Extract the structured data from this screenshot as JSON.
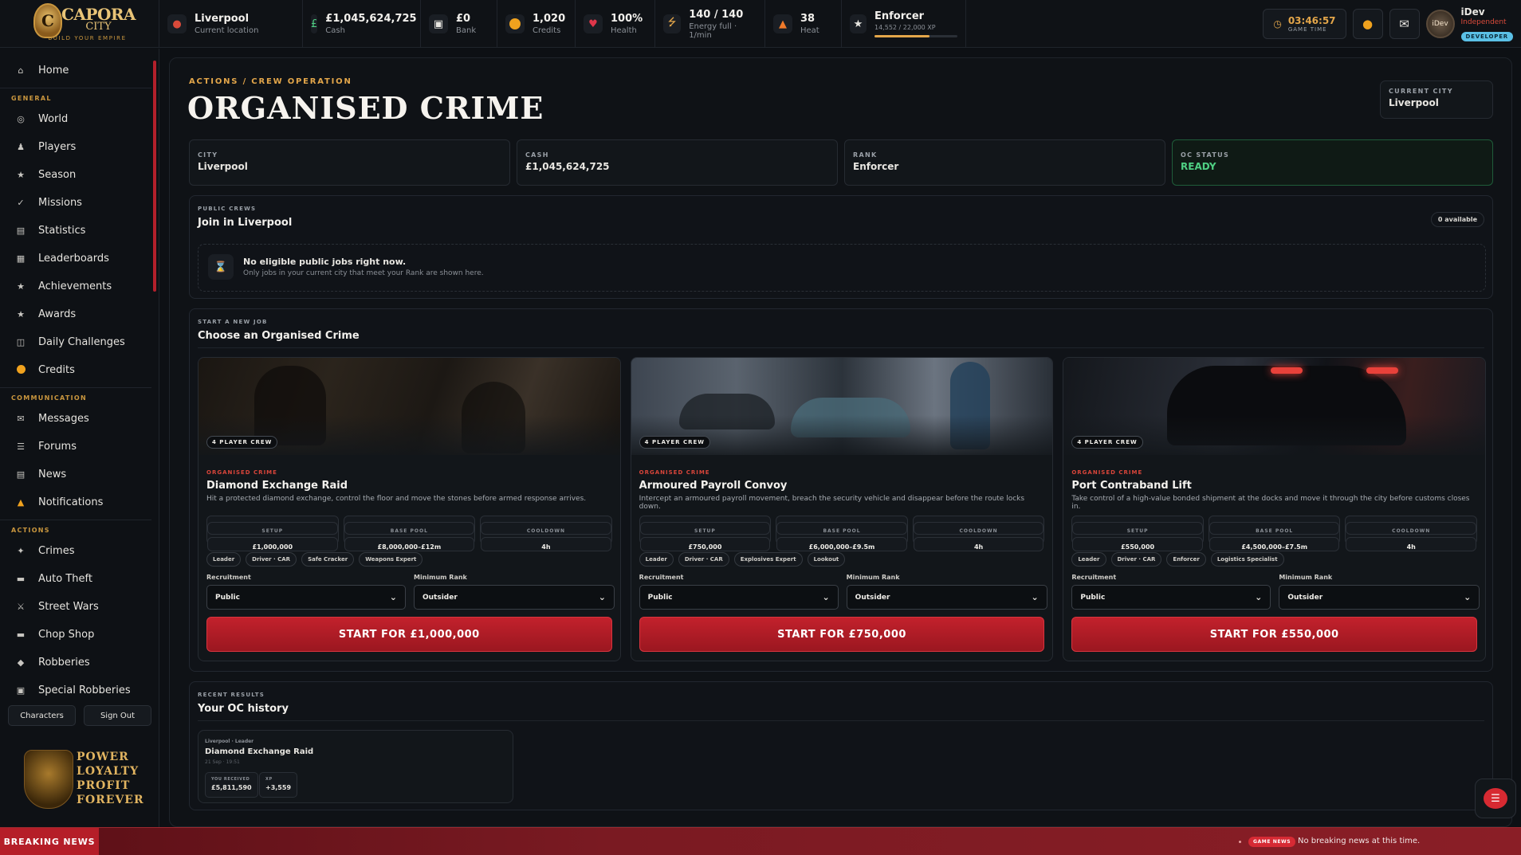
{
  "brand": {
    "name_line1": "CAPORA",
    "name_line2": "CITY",
    "tagline": "BUILD YOUR EMPIRE",
    "crest_letter": "C"
  },
  "topbar": {
    "location": {
      "value": "Liverpool",
      "label": "Current location",
      "icon": "location-pin-icon"
    },
    "cash": {
      "value": "£1,045,624,725",
      "label": "Cash",
      "icon": "pound-icon"
    },
    "bank": {
      "value": "£0",
      "label": "Bank",
      "icon": "bank-icon"
    },
    "credits": {
      "value": "1,020",
      "label": "Credits",
      "icon": "coin-icon"
    },
    "health": {
      "value": "100%",
      "label": "Health",
      "icon": "heart-icon"
    },
    "energy": {
      "value": "140 / 140",
      "label": "Energy full · 1/min",
      "icon": "bolt-icon"
    },
    "heat": {
      "value": "38",
      "label": "Heat",
      "icon": "flame-icon"
    },
    "rank": {
      "value": "Enforcer",
      "xp": "14,552 / 22,000 XP",
      "xp_fraction": 0.66,
      "icon": "rank-icon"
    },
    "game_time": {
      "value": "03:46:57",
      "label": "GAME TIME"
    },
    "user": {
      "name": "iDev",
      "faction": "Independent",
      "badge": "DEVELOPER",
      "avatar_text": "iDev"
    }
  },
  "sidebar": {
    "home": "Home",
    "sections": [
      {
        "title": "GENERAL",
        "items": [
          "World",
          "Players",
          "Season",
          "Missions",
          "Statistics",
          "Leaderboards",
          "Achievements",
          "Awards",
          "Daily Challenges",
          "Credits"
        ]
      },
      {
        "title": "COMMUNICATION",
        "items": [
          "Messages",
          "Forums",
          "News",
          "Notifications"
        ]
      },
      {
        "title": "ACTIONS",
        "items": [
          "Crimes",
          "Auto Theft",
          "Street Wars",
          "Chop Shop",
          "Robberies",
          "Special Robberies"
        ]
      }
    ],
    "characters_btn": "Characters",
    "signout_btn": "Sign Out",
    "motto": [
      "POWER",
      "LOYALTY",
      "PROFIT",
      "FOREVER"
    ]
  },
  "page": {
    "breadcrumb": "ACTIONS / CREW OPERATION",
    "title": "ORGANISED CRIME",
    "current_city_label": "CURRENT CITY",
    "current_city": "Liverpool",
    "stats": [
      {
        "label": "CITY",
        "value": "Liverpool"
      },
      {
        "label": "CASH",
        "value": "£1,045,624,725"
      },
      {
        "label": "RANK",
        "value": "Enforcer"
      },
      {
        "label": "OC STATUS",
        "value": "READY"
      }
    ],
    "public_crews": {
      "label": "PUBLIC CREWS",
      "title": "Join in Liverpool",
      "available": "0 available",
      "empty_title": "No eligible public jobs right now.",
      "empty_sub": "Only jobs in your current city that meet your Rank are shown here."
    },
    "new_job": {
      "label": "START A NEW JOB",
      "title": "Choose an Organised Crime",
      "recruitment_label": "Recruitment",
      "min_rank_label": "Minimum Rank",
      "setup_label": "SETUP",
      "pool_label": "BASE POOL",
      "cooldown_label": "COOLDOWN",
      "cards": [
        {
          "crew": "4 PLAYER CREW",
          "tag": "ORGANISED CRIME",
          "name": "Diamond Exchange Raid",
          "desc": "Hit a protected diamond exchange, control the floor and move the stones before armed response arrives.",
          "setup": "£1,000,000",
          "pool": "£8,000,000–£12m",
          "cooldown": "4h",
          "roles": [
            "Leader",
            "Driver · CAR",
            "Safe Cracker",
            "Weapons Expert"
          ],
          "recruitment": "Public",
          "min_rank": "Outsider",
          "button": "START FOR £1,000,000"
        },
        {
          "crew": "4 PLAYER CREW",
          "tag": "ORGANISED CRIME",
          "name": "Armoured Payroll Convoy",
          "desc": "Intercept an armoured payroll movement, breach the security vehicle and disappear before the route locks down.",
          "setup": "£750,000",
          "pool": "£6,000,000–£9.5m",
          "cooldown": "4h",
          "roles": [
            "Leader",
            "Driver · CAR",
            "Explosives Expert",
            "Lookout"
          ],
          "recruitment": "Public",
          "min_rank": "Outsider",
          "button": "START FOR £750,000"
        },
        {
          "crew": "4 PLAYER CREW",
          "tag": "ORGANISED CRIME",
          "name": "Port Contraband Lift",
          "desc": "Take control of a high-value bonded shipment at the docks and move it through the city before customs closes in.",
          "setup": "£550,000",
          "pool": "£4,500,000–£7.5m",
          "cooldown": "4h",
          "roles": [
            "Leader",
            "Driver · CAR",
            "Enforcer",
            "Logistics Specialist"
          ],
          "recruitment": "Public",
          "min_rank": "Outsider",
          "button": "START FOR £550,000"
        }
      ]
    },
    "history": {
      "label": "RECENT RESULTS",
      "title": "Your OC history",
      "entry": {
        "meta": "Liverpool · Leader",
        "name": "Diamond Exchange Raid",
        "date": "21 Sep · 19:51",
        "received_label": "YOU RECEIVED",
        "received": "£5,811,590",
        "xp_label": "XP",
        "xp": "+3,559"
      }
    }
  },
  "ticker": {
    "label": "BREAKING NEWS",
    "badge": "GAME NEWS",
    "text": "No breaking news at this time."
  }
}
